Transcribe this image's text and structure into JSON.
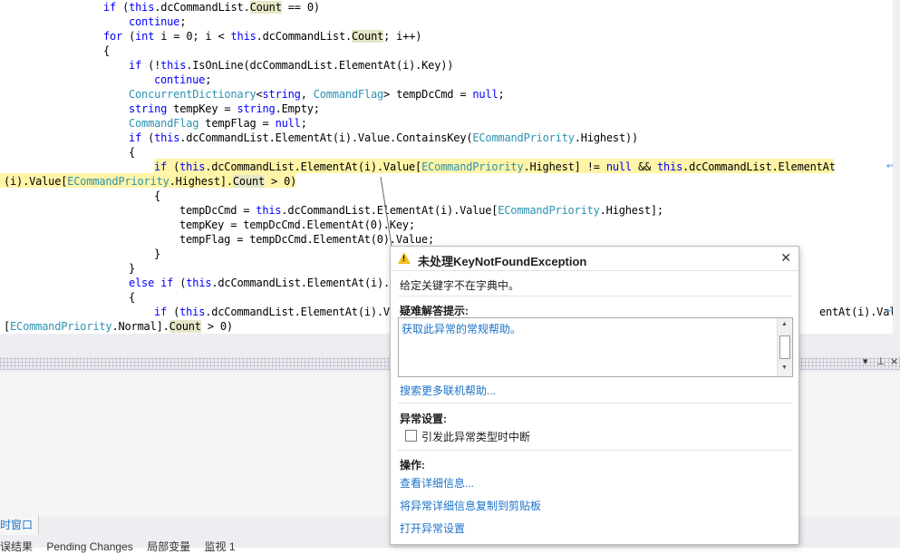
{
  "code": {
    "l1": {
      "a": "if",
      "b": " (",
      "c": "this",
      "d": ".dcCommandList.",
      "e": "Count",
      "f": " == 0)"
    },
    "l2": {
      "a": "continue",
      "b": ";"
    },
    "l3": {
      "a": "for",
      "b": " (",
      "c": "int",
      "d": " i = 0; i < ",
      "e": "this",
      "f": ".dcCommandList.",
      "g": "Count",
      "h": "; i++)"
    },
    "l4": "{",
    "l5": {
      "a": "if",
      "b": " (!",
      "c": "this",
      "d": ".IsOnLine(dcCommandList.ElementAt(i).Key))"
    },
    "l6": {
      "a": "continue",
      "b": ";"
    },
    "l7": {
      "a": "ConcurrentDictionary",
      "b": "<",
      "c": "string",
      "d": ", ",
      "e": "CommandFlag",
      "f": "> tempDcCmd = ",
      "g": "null",
      "h": ";"
    },
    "l8": {
      "a": "string",
      "b": " tempKey = ",
      "c": "string",
      "d": ".Empty;"
    },
    "l9": {
      "a": "CommandFlag",
      "b": " tempFlag = ",
      "c": "null",
      "d": ";"
    },
    "l10": {
      "a": "if",
      "b": " (",
      "c": "this",
      "d": ".dcCommandList.ElementAt(i).Value.ContainsKey(",
      "e": "ECommandPriority",
      "f": ".Highest))"
    },
    "l11": "{",
    "l12": {
      "a": "if",
      "b": " (",
      "c": "this",
      "d": ".dcCommandList.ElementAt(i).Value[",
      "e": "ECommandPriority",
      "f": ".Highest] != ",
      "g": "null",
      "h": " && ",
      "i": "this",
      "j": ".dcCommandList.ElementAt"
    },
    "l13": {
      "a": "(i).Value[",
      "b": "ECommandPriority",
      "c": ".Highest].",
      "d": "Count",
      "e": " > 0)"
    },
    "l14": "{",
    "l15": {
      "a": "tempDcCmd = ",
      "b": "this",
      "c": ".dcCommandList.ElementAt(i).Value[",
      "d": "ECommandPriority",
      "e": ".Highest];"
    },
    "l16": "tempKey = tempDcCmd.ElementAt(0).Key;",
    "l17": "tempFlag = tempDcCmd.ElementAt(0).Value;",
    "l18": "}",
    "l19": "}",
    "l20": {
      "a": "else",
      "b": " ",
      "c": "if",
      "d": " (",
      "e": "this",
      "f": ".dcCommandList.ElementAt(i)."
    },
    "l21": "{",
    "l22": {
      "a": "if",
      "b": " (",
      "c": "this",
      "d": ".dcCommandList.ElementAt(i).V",
      "e": "entAt(i).Value"
    },
    "l23": {
      "a": "[",
      "b": "ECommandPriority",
      "c": ".Normal].",
      "d": "Count",
      "e": " > 0)"
    }
  },
  "bottom": {
    "tool_tab": "时窗口",
    "tabs": [
      "误结果",
      "Pending Changes",
      "局部变量",
      "监视 1"
    ]
  },
  "panel_controls": {
    "dropdown": "▾",
    "pin": "⊥",
    "close": "×"
  },
  "exception": {
    "title": "未处理KeyNotFoundException",
    "message": "给定关键字不在字典中。",
    "tips_heading": "疑难解答提示:",
    "tips_link": "获取此异常的常规帮助。",
    "search_link": "搜索更多联机帮助...",
    "settings_heading": "异常设置:",
    "break_checkbox_label": "引发此异常类型时中断",
    "break_checked": false,
    "actions_heading": "操作:",
    "action_details": "查看详细信息...",
    "action_copy": "将异常详细信息复制到剪贴板",
    "action_settings": "打开异常设置"
  }
}
